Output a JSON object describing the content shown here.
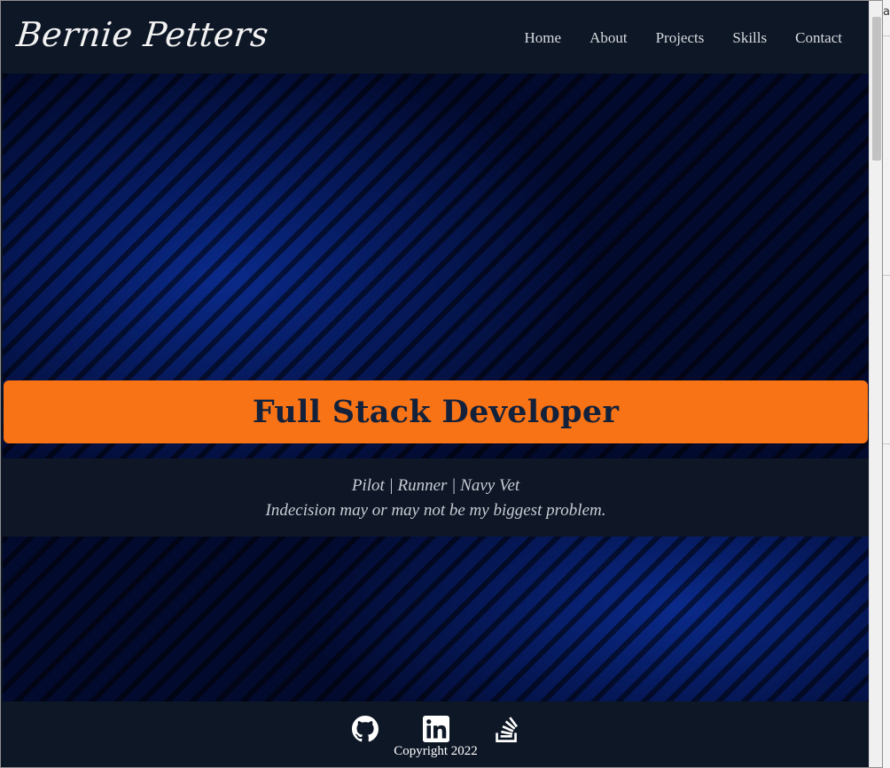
{
  "background_fragment": "a",
  "navbar": {
    "brand": "Bernie Petters",
    "links": [
      "Home",
      "About",
      "Projects",
      "Skills",
      "Contact"
    ]
  },
  "hero": {
    "headline": "Full Stack Developer",
    "tagline_line1": "Pilot | Runner | Navy Vet",
    "tagline_line2": "Indecision may or may not be my biggest problem."
  },
  "footer": {
    "icons": [
      "github-icon",
      "linkedin-icon",
      "stackoverflow-icon"
    ],
    "copyright": "Copyright 2022"
  },
  "colors": {
    "navbar_bg": "#0e1726",
    "accent_orange": "#f87315",
    "headline_text": "#14213a",
    "hero_blue": "#0a2a8a"
  }
}
